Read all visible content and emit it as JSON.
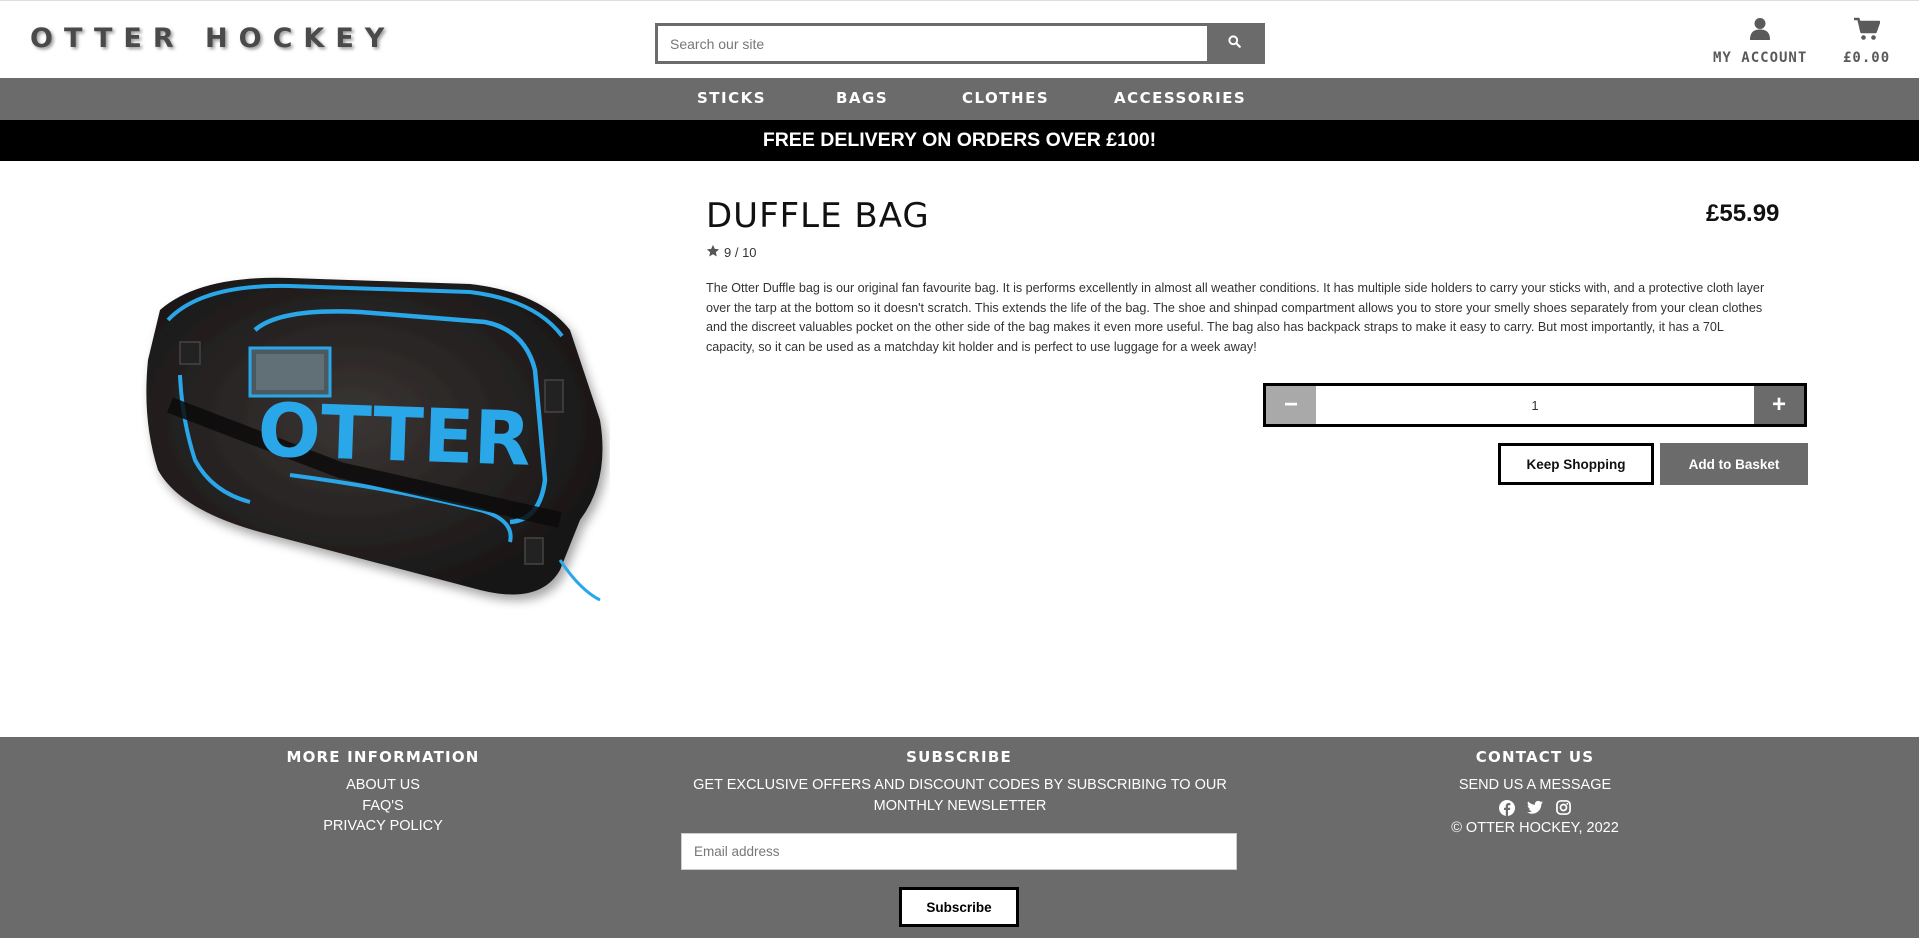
{
  "header": {
    "logo": "OTTER HOCKEY",
    "search_placeholder": "Search our site",
    "account_label": "MY ACCOUNT",
    "cart_total": "£0.00"
  },
  "nav": {
    "items": [
      {
        "label": "STICKS"
      },
      {
        "label": "BAGS"
      },
      {
        "label": "CLOTHES"
      },
      {
        "label": "ACCESSORIES"
      }
    ]
  },
  "promo": "FREE DELIVERY ON ORDERS OVER £100!",
  "product": {
    "name": "DUFFLE BAG",
    "price": "£55.99",
    "rating": "9 / 10",
    "description": "The Otter Duffle bag is our original fan favourite bag. It is performs excellently in almost all weather conditions. It has multiple side holders to carry your sticks with, and a protective cloth layer over the tarp at the bottom so it doesn't scratch. This extends the life of the bag. The shoe and shinpad compartment allows you to store your smelly shoes separately from your clean clothes and the discreet valuables pocket on the other side of the bag makes it even more useful. The bag also has backpack straps to make it easy to carry. But most importantly, it has a 70L capacity, so it can be used as a matchday kit holder and is perfect to use luggage for a week away!",
    "image_text": "OTTER",
    "quantity": "1",
    "minus_label": "−",
    "plus_label": "+",
    "keep_shopping": "Keep Shopping",
    "add_to_basket": "Add to Basket"
  },
  "footer": {
    "more_info": {
      "heading": "MORE INFORMATION",
      "links": [
        "ABOUT US",
        "FAQ'S",
        "PRIVACY POLICY"
      ]
    },
    "subscribe": {
      "heading": "SUBSCRIBE",
      "text": "GET EXCLUSIVE OFFERS AND DISCOUNT CODES BY SUBSCRIBING TO OUR MONTHLY NEWSLETTER",
      "email_placeholder": "Email address",
      "button": "Subscribe"
    },
    "contact": {
      "heading": "CONTACT US",
      "link": "SEND US A MESSAGE",
      "copyright": "© OTTER HOCKEY, 2022"
    }
  },
  "colors": {
    "primary_grey": "#6b6b6b",
    "light_grey": "#a9a9a9",
    "promo_bg": "#000000",
    "bag_accent": "#2aa7e8"
  },
  "icons": [
    "search-icon",
    "user-icon",
    "cart-icon",
    "star-icon",
    "facebook-icon",
    "twitter-icon",
    "instagram-icon"
  ]
}
